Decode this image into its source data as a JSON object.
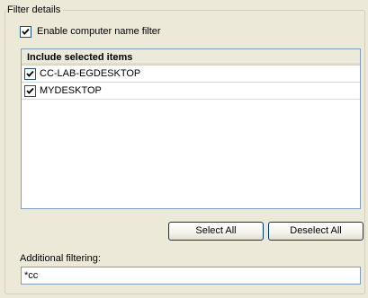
{
  "filter_group": {
    "title": "Filter details",
    "enable_filter": {
      "label": "Enable computer name filter",
      "checked": true
    },
    "list": {
      "header": "Include selected items",
      "items": [
        {
          "label": "CC-LAB-EGDESKTOP",
          "checked": true
        },
        {
          "label": "MYDESKTOP",
          "checked": true
        }
      ]
    },
    "buttons": {
      "select_all": "Select All",
      "deselect_all": "Deselect All"
    },
    "additional_filtering": {
      "label": "Additional filtering:",
      "value": "*cc"
    }
  }
}
